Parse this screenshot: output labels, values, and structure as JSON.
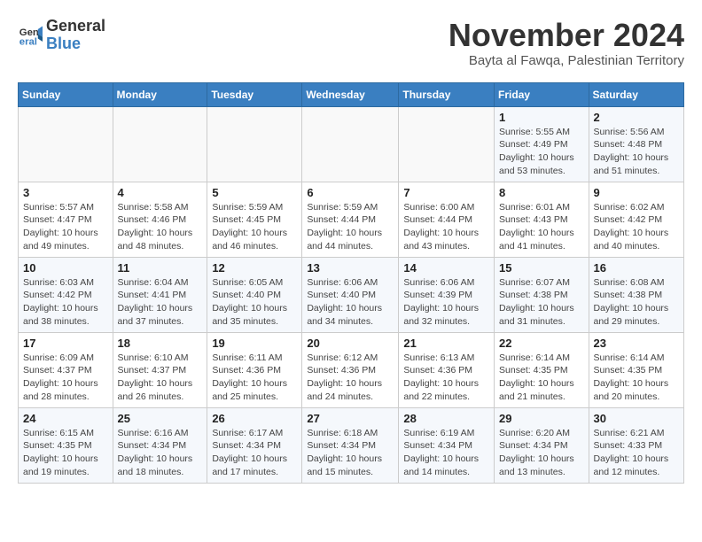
{
  "logo": {
    "text_general": "General",
    "text_blue": "Blue"
  },
  "title": "November 2024",
  "subtitle": "Bayta al Fawqa, Palestinian Territory",
  "weekdays": [
    "Sunday",
    "Monday",
    "Tuesday",
    "Wednesday",
    "Thursday",
    "Friday",
    "Saturday"
  ],
  "weeks": [
    [
      {
        "day": "",
        "info": ""
      },
      {
        "day": "",
        "info": ""
      },
      {
        "day": "",
        "info": ""
      },
      {
        "day": "",
        "info": ""
      },
      {
        "day": "",
        "info": ""
      },
      {
        "day": "1",
        "info": "Sunrise: 5:55 AM\nSunset: 4:49 PM\nDaylight: 10 hours and 53 minutes."
      },
      {
        "day": "2",
        "info": "Sunrise: 5:56 AM\nSunset: 4:48 PM\nDaylight: 10 hours and 51 minutes."
      }
    ],
    [
      {
        "day": "3",
        "info": "Sunrise: 5:57 AM\nSunset: 4:47 PM\nDaylight: 10 hours and 49 minutes."
      },
      {
        "day": "4",
        "info": "Sunrise: 5:58 AM\nSunset: 4:46 PM\nDaylight: 10 hours and 48 minutes."
      },
      {
        "day": "5",
        "info": "Sunrise: 5:59 AM\nSunset: 4:45 PM\nDaylight: 10 hours and 46 minutes."
      },
      {
        "day": "6",
        "info": "Sunrise: 5:59 AM\nSunset: 4:44 PM\nDaylight: 10 hours and 44 minutes."
      },
      {
        "day": "7",
        "info": "Sunrise: 6:00 AM\nSunset: 4:44 PM\nDaylight: 10 hours and 43 minutes."
      },
      {
        "day": "8",
        "info": "Sunrise: 6:01 AM\nSunset: 4:43 PM\nDaylight: 10 hours and 41 minutes."
      },
      {
        "day": "9",
        "info": "Sunrise: 6:02 AM\nSunset: 4:42 PM\nDaylight: 10 hours and 40 minutes."
      }
    ],
    [
      {
        "day": "10",
        "info": "Sunrise: 6:03 AM\nSunset: 4:42 PM\nDaylight: 10 hours and 38 minutes."
      },
      {
        "day": "11",
        "info": "Sunrise: 6:04 AM\nSunset: 4:41 PM\nDaylight: 10 hours and 37 minutes."
      },
      {
        "day": "12",
        "info": "Sunrise: 6:05 AM\nSunset: 4:40 PM\nDaylight: 10 hours and 35 minutes."
      },
      {
        "day": "13",
        "info": "Sunrise: 6:06 AM\nSunset: 4:40 PM\nDaylight: 10 hours and 34 minutes."
      },
      {
        "day": "14",
        "info": "Sunrise: 6:06 AM\nSunset: 4:39 PM\nDaylight: 10 hours and 32 minutes."
      },
      {
        "day": "15",
        "info": "Sunrise: 6:07 AM\nSunset: 4:38 PM\nDaylight: 10 hours and 31 minutes."
      },
      {
        "day": "16",
        "info": "Sunrise: 6:08 AM\nSunset: 4:38 PM\nDaylight: 10 hours and 29 minutes."
      }
    ],
    [
      {
        "day": "17",
        "info": "Sunrise: 6:09 AM\nSunset: 4:37 PM\nDaylight: 10 hours and 28 minutes."
      },
      {
        "day": "18",
        "info": "Sunrise: 6:10 AM\nSunset: 4:37 PM\nDaylight: 10 hours and 26 minutes."
      },
      {
        "day": "19",
        "info": "Sunrise: 6:11 AM\nSunset: 4:36 PM\nDaylight: 10 hours and 25 minutes."
      },
      {
        "day": "20",
        "info": "Sunrise: 6:12 AM\nSunset: 4:36 PM\nDaylight: 10 hours and 24 minutes."
      },
      {
        "day": "21",
        "info": "Sunrise: 6:13 AM\nSunset: 4:36 PM\nDaylight: 10 hours and 22 minutes."
      },
      {
        "day": "22",
        "info": "Sunrise: 6:14 AM\nSunset: 4:35 PM\nDaylight: 10 hours and 21 minutes."
      },
      {
        "day": "23",
        "info": "Sunrise: 6:14 AM\nSunset: 4:35 PM\nDaylight: 10 hours and 20 minutes."
      }
    ],
    [
      {
        "day": "24",
        "info": "Sunrise: 6:15 AM\nSunset: 4:35 PM\nDaylight: 10 hours and 19 minutes."
      },
      {
        "day": "25",
        "info": "Sunrise: 6:16 AM\nSunset: 4:34 PM\nDaylight: 10 hours and 18 minutes."
      },
      {
        "day": "26",
        "info": "Sunrise: 6:17 AM\nSunset: 4:34 PM\nDaylight: 10 hours and 17 minutes."
      },
      {
        "day": "27",
        "info": "Sunrise: 6:18 AM\nSunset: 4:34 PM\nDaylight: 10 hours and 15 minutes."
      },
      {
        "day": "28",
        "info": "Sunrise: 6:19 AM\nSunset: 4:34 PM\nDaylight: 10 hours and 14 minutes."
      },
      {
        "day": "29",
        "info": "Sunrise: 6:20 AM\nSunset: 4:34 PM\nDaylight: 10 hours and 13 minutes."
      },
      {
        "day": "30",
        "info": "Sunrise: 6:21 AM\nSunset: 4:33 PM\nDaylight: 10 hours and 12 minutes."
      }
    ]
  ]
}
